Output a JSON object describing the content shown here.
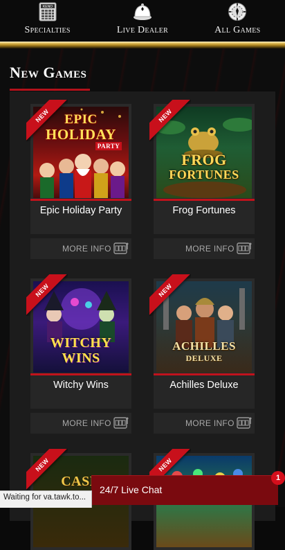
{
  "nav": {
    "items": [
      {
        "label": "Specialties",
        "icon": "keno-board-icon",
        "icon_text": "KENO"
      },
      {
        "label": "Live Dealer",
        "icon": "dealer-bell-icon"
      },
      {
        "label": "All Games",
        "icon": "chip-icon"
      }
    ]
  },
  "section": {
    "title": "New Games"
  },
  "games": [
    {
      "name": "Epic Holiday Party",
      "badge": "NEW",
      "more": "MORE INFO",
      "logo_line1": "EPIC",
      "logo_line2": "HOLIDAY",
      "logo_line3": "PARTY"
    },
    {
      "name": "Frog Fortunes",
      "badge": "NEW",
      "more": "MORE INFO",
      "logo_line1": "FROG",
      "logo_line2": "FORTUNES"
    },
    {
      "name": "Witchy Wins",
      "badge": "NEW",
      "more": "MORE INFO",
      "logo_line1": "WITCHY",
      "logo_line2": "WINS"
    },
    {
      "name": "Achilles Deluxe",
      "badge": "NEW",
      "more": "MORE INFO",
      "logo_line1": "ACHILLES",
      "logo_line2": "DELUXE"
    },
    {
      "name": "",
      "badge": "NEW",
      "logo_line1": "CASH"
    },
    {
      "name": "",
      "badge": "NEW"
    }
  ],
  "chat": {
    "label": "24/7 Live Chat",
    "badge_count": "1"
  },
  "status": {
    "text": "Waiting for va.tawk.to..."
  },
  "colors": {
    "accent_red": "#c8101b",
    "gold": "#d9b24a",
    "panel": "#1c1c1c"
  }
}
